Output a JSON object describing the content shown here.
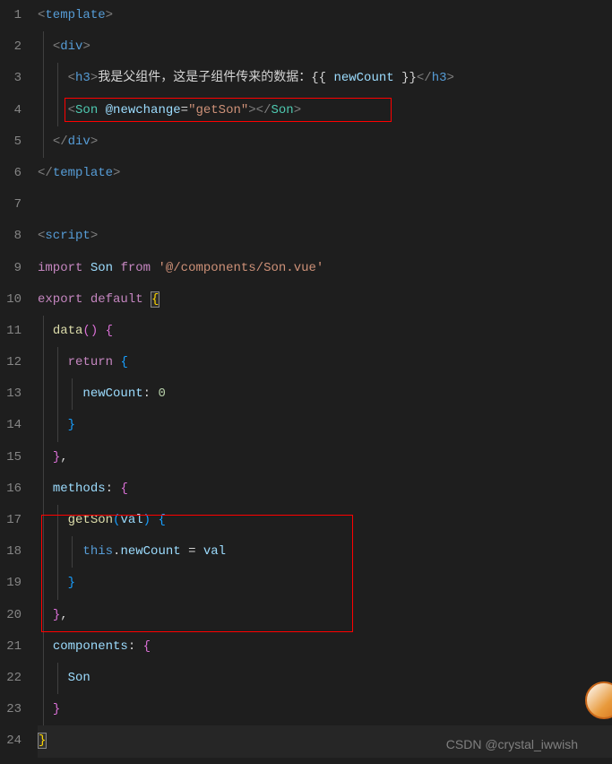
{
  "lines": [
    "1",
    "2",
    "3",
    "4",
    "5",
    "6",
    "7",
    "8",
    "9",
    "10",
    "11",
    "12",
    "13",
    "14",
    "15",
    "16",
    "17",
    "18",
    "19",
    "20",
    "21",
    "22",
    "23",
    "24"
  ],
  "code": {
    "l1": {
      "tag": "template"
    },
    "l2": {
      "tag": "div"
    },
    "l3": {
      "tag": "h3",
      "text": "我是父组件，这是子组件传来的数据：",
      "expr": "newCount"
    },
    "l4": {
      "tag": "Son",
      "attr": "@newchange",
      "val": "\"getSon\""
    },
    "l5": {
      "tag": "div"
    },
    "l6": {
      "tag": "template"
    },
    "l8": {
      "tag": "script"
    },
    "l9": {
      "kw": "import",
      "name": "Son",
      "from": "from",
      "path": "'@/components/Son.vue'"
    },
    "l10": {
      "kw": "export",
      "kw2": "default"
    },
    "l11": {
      "fn": "data"
    },
    "l12": {
      "kw": "return"
    },
    "l13": {
      "prop": "newCount",
      "val": "0"
    },
    "l16": {
      "prop": "methods"
    },
    "l17": {
      "fn": "getSon",
      "arg": "val"
    },
    "l18": {
      "this": "this",
      "prop": "newCount",
      "val": "val"
    },
    "l21": {
      "prop": "components"
    },
    "l22": {
      "prop": "Son"
    }
  },
  "watermark": "CSDN @crystal_iwwish"
}
